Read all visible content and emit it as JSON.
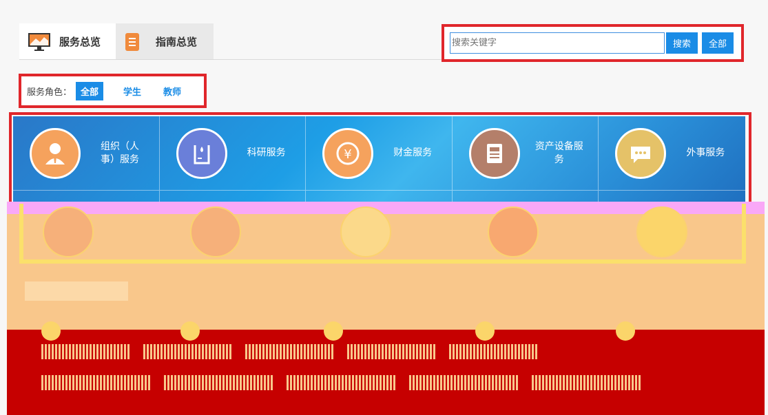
{
  "tabs": [
    {
      "label": "服务总览",
      "icon": "monitor-chart-icon",
      "active": true
    },
    {
      "label": "指南总览",
      "icon": "notebook-icon",
      "active": false
    }
  ],
  "search": {
    "placeholder": "搜索关键字",
    "search_label": "搜索",
    "all_label": "全部"
  },
  "role_filter": {
    "label": "服务角色：",
    "options": [
      "全部",
      "学生",
      "教师"
    ],
    "selected": "全部"
  },
  "services_row1": [
    {
      "label": "组织（人事）服务",
      "icon": "person-icon",
      "color": "#f5a25d"
    },
    {
      "label": "科研服务",
      "icon": "beaker-icon",
      "color": "#6a7fd9"
    },
    {
      "label": "财金服务",
      "icon": "yuan-icon",
      "color": "#f5a25d"
    },
    {
      "label": "资产设备服务",
      "icon": "document-icon",
      "color": "#b47f6a"
    },
    {
      "label": "外事服务",
      "icon": "chat-bubble-icon",
      "color": "#e5c268"
    }
  ],
  "colors": {
    "accent": "#1a8ce6",
    "highlight_border": "#e0262b"
  }
}
